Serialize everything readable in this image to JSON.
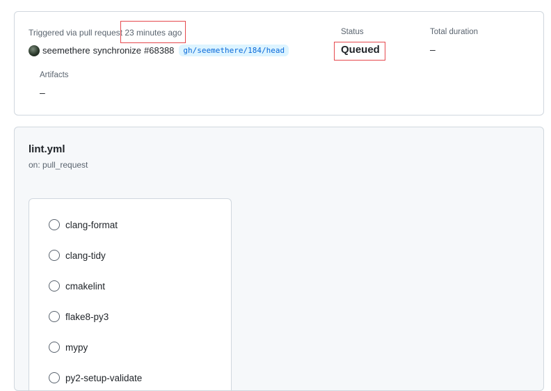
{
  "summary": {
    "trigger_prefix": "Triggered via pull request",
    "time_ago": "23 minutes ago",
    "actor": "seemethere",
    "event": "synchronize",
    "pr_number": "#68388",
    "branch": "gh/seemethere/184/head",
    "status_label": "Status",
    "status_value": "Queued",
    "duration_label": "Total duration",
    "duration_value": "–",
    "artifacts_label": "Artifacts",
    "artifacts_value": "–"
  },
  "workflow": {
    "name": "lint.yml",
    "trigger": "on: pull_request",
    "jobs": [
      {
        "label": "clang-format",
        "icon": "pending-circle-icon"
      },
      {
        "label": "clang-tidy",
        "icon": "pending-circle-icon"
      },
      {
        "label": "cmakelint",
        "icon": "pending-circle-icon"
      },
      {
        "label": "flake8-py3",
        "icon": "pending-circle-icon"
      },
      {
        "label": "mypy",
        "icon": "pending-circle-icon"
      },
      {
        "label": "py2-setup-validate",
        "icon": "pending-circle-icon"
      }
    ]
  },
  "colors": {
    "highlight": "#e5484d",
    "branch_text": "#0969da",
    "branch_bg": "#ddf4ff",
    "panel_bg": "#f6f8fa",
    "border": "#d0d7de"
  }
}
